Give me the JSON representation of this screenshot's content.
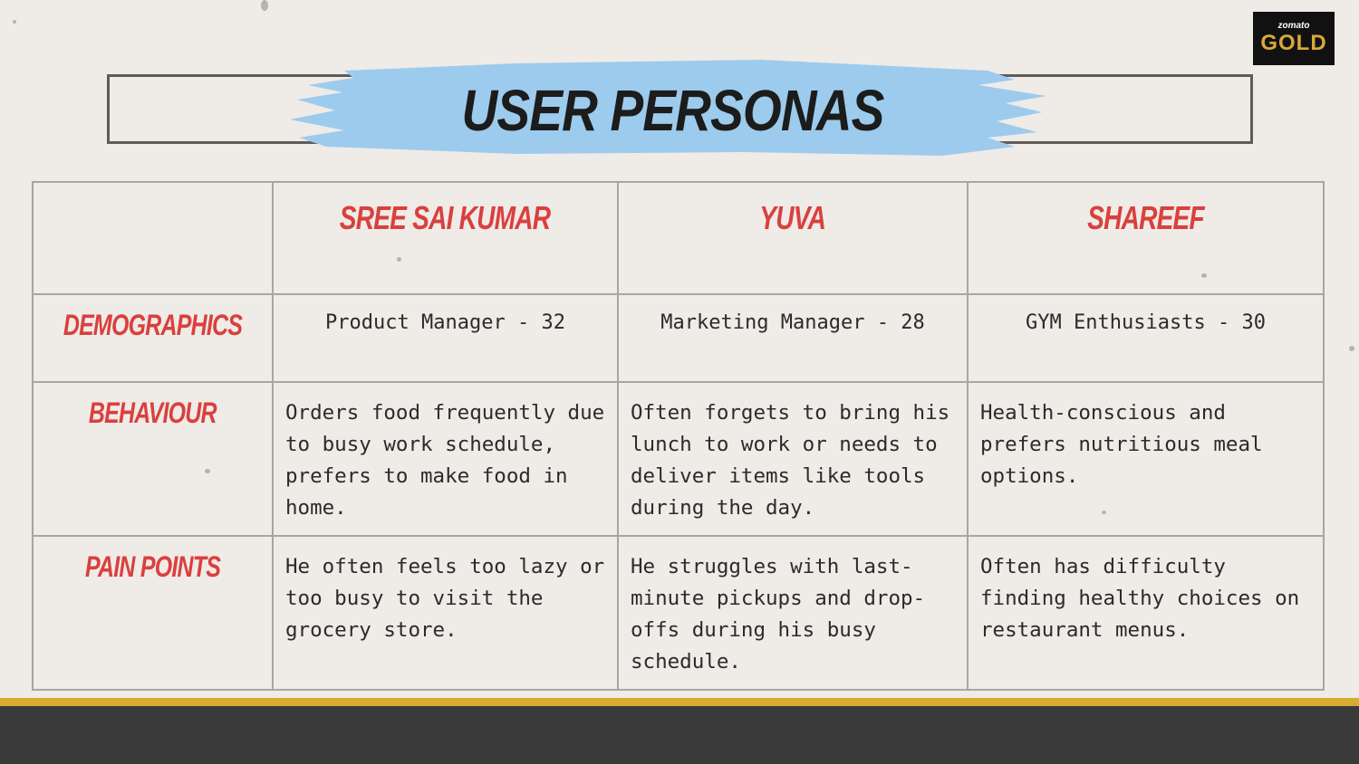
{
  "logo": {
    "small": "zomato",
    "big": "GOLD"
  },
  "title": "USER PERSONAS",
  "table": {
    "columns": [
      "SREE SAI KUMAR",
      "YUVA",
      "SHAREEF"
    ],
    "rows": [
      {
        "label": "DEMOGRAPHICS",
        "cells": [
          "Product Manager - 32",
          "Marketing Manager - 28",
          "GYM Enthusiasts - 30"
        ]
      },
      {
        "label": "BEHAVIOUR",
        "cells": [
          "Orders food frequently due to busy work schedule, prefers to make food in home.",
          "Often forgets to bring his lunch to work or needs to deliver items like tools during the day.",
          "Health-conscious and prefers nutritious meal options."
        ]
      },
      {
        "label": "PAIN POINTS",
        "cells": [
          "He often feels too lazy or too busy to visit the grocery store.",
          "He struggles with last-minute pickups and drop-offs during his busy schedule.",
          "Often has difficulty finding healthy choices on restaurant menus."
        ]
      }
    ]
  },
  "colors": {
    "accent_red": "#d9403e",
    "brush_blue": "#9dcbed",
    "gold": "#d8ac2e",
    "dark": "#3a3a3a"
  }
}
